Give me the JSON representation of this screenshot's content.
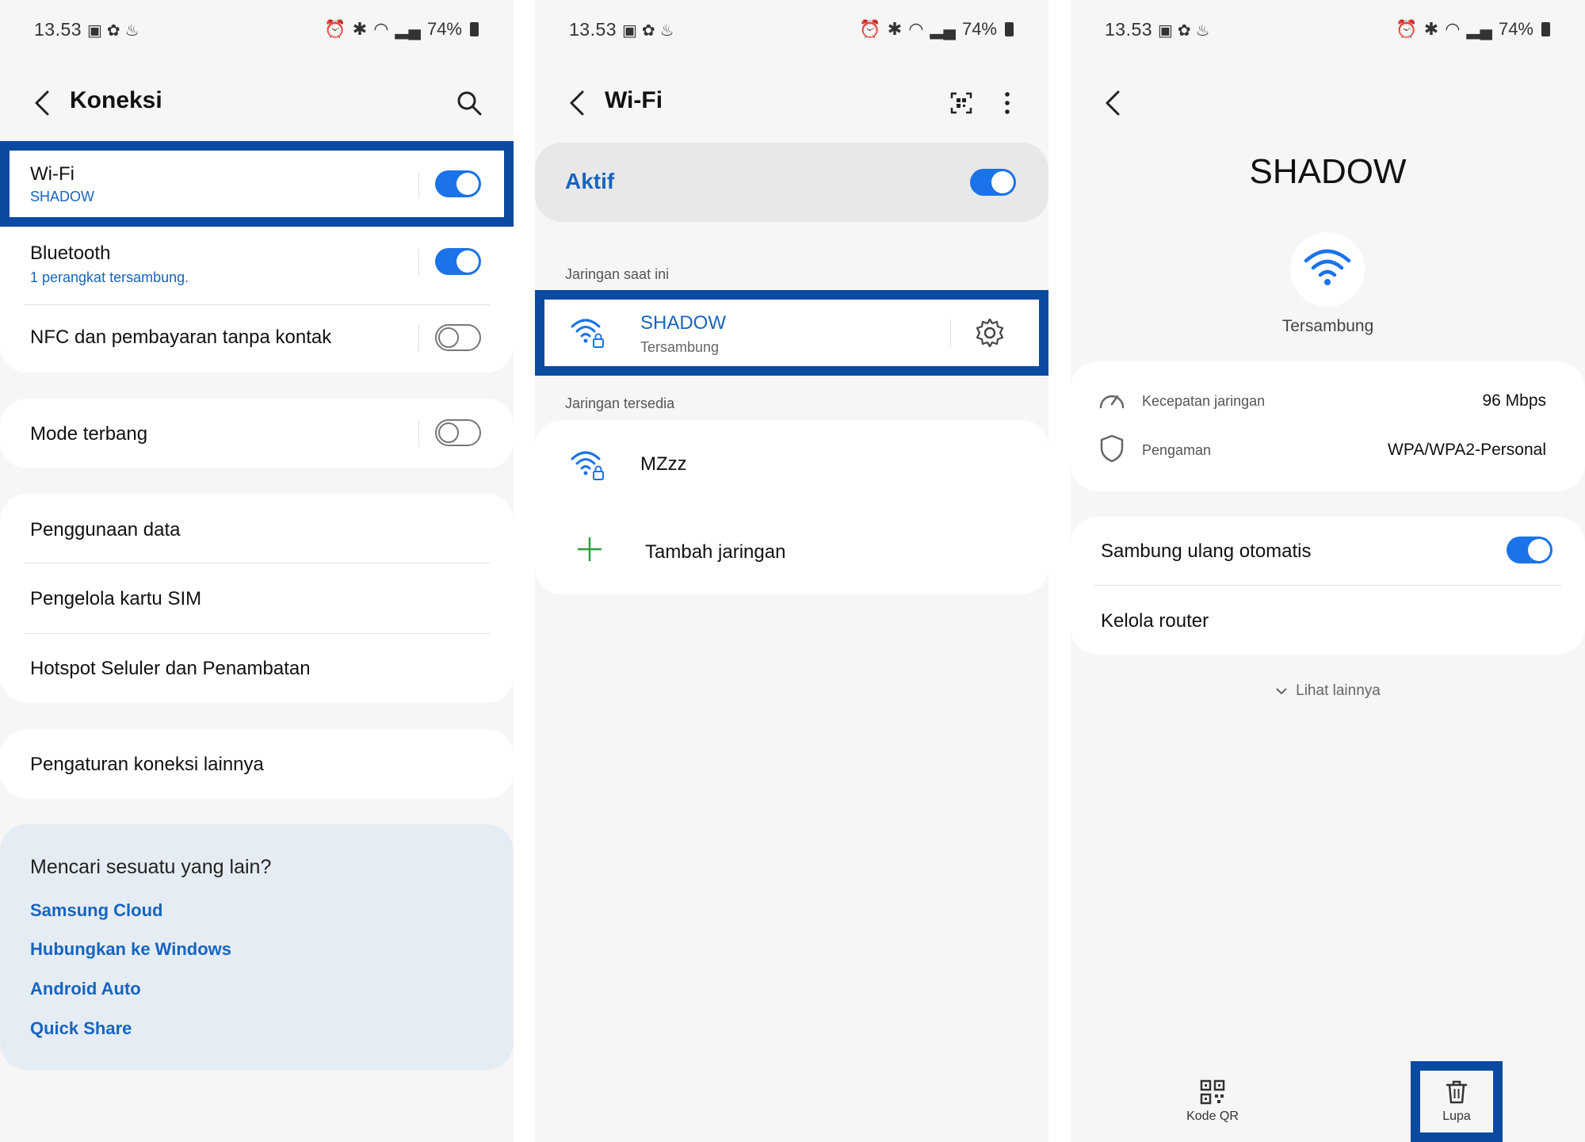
{
  "status_bar": {
    "time": "13.53",
    "battery": "74%"
  },
  "screen1": {
    "title": "Koneksi",
    "wifi": {
      "label": "Wi-Fi",
      "sub": "SHADOW",
      "on": true
    },
    "bluetooth": {
      "label": "Bluetooth",
      "sub": "1 perangkat tersambung.",
      "on": true
    },
    "nfc": {
      "label": "NFC dan pembayaran tanpa kontak",
      "on": false
    },
    "airplane": {
      "label": "Mode terbang",
      "on": false
    },
    "data_usage": "Penggunaan data",
    "sim_manager": "Pengelola kartu SIM",
    "hotspot": "Hotspot Seluler dan Penambatan",
    "more_settings": "Pengaturan koneksi lainnya",
    "suggest": {
      "title": "Mencari sesuatu yang lain?",
      "links": [
        "Samsung Cloud",
        "Hubungkan ke Windows",
        "Android Auto",
        "Quick Share"
      ]
    }
  },
  "screen2": {
    "title": "Wi-Fi",
    "active_label": "Aktif",
    "current_section": "Jaringan saat ini",
    "current_network": {
      "name": "SHADOW",
      "status": "Tersambung"
    },
    "available_section": "Jaringan tersedia",
    "available_networks": [
      "MZzz"
    ],
    "add_network": "Tambah jaringan"
  },
  "screen3": {
    "network_name": "SHADOW",
    "status": "Tersambung",
    "details": [
      {
        "label": "Kecepatan jaringan",
        "value": "96 Mbps"
      },
      {
        "label": "Pengaman",
        "value": "WPA/WPA2-Personal"
      }
    ],
    "auto_reconnect": {
      "label": "Sambung ulang otomatis",
      "on": true
    },
    "manage_router": "Kelola router",
    "see_more": "Lihat lainnya",
    "bottom_actions": {
      "qr": "Kode QR",
      "forget": "Lupa"
    }
  },
  "colors": {
    "accent": "#1a73e8",
    "highlight": "#0a4aa0",
    "link": "#1565c0",
    "add": "#2e9e3e"
  }
}
